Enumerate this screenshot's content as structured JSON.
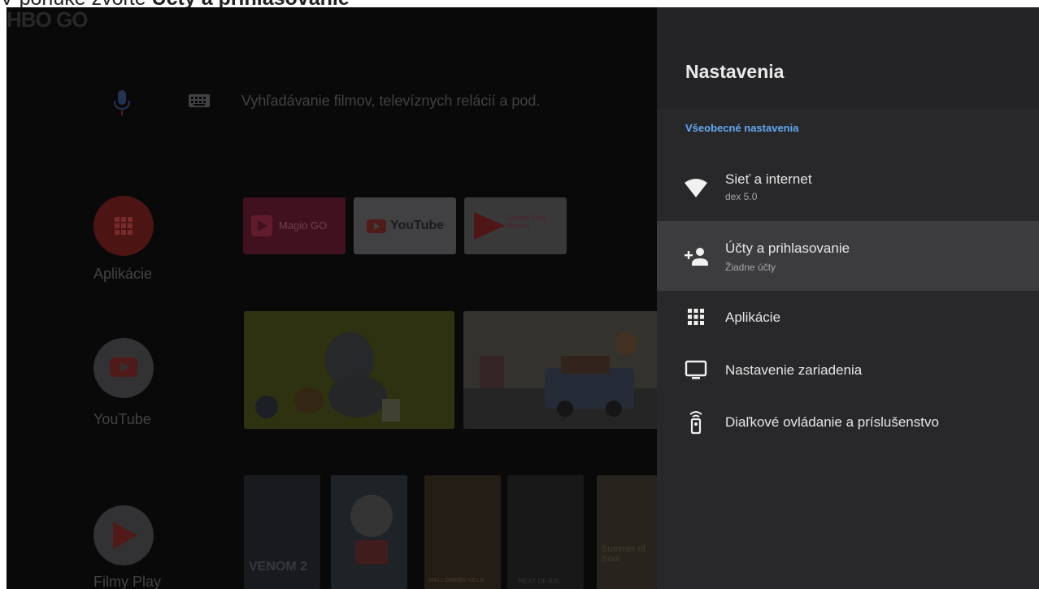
{
  "caption": {
    "prefix": "V ponuke zvoľte ",
    "highlight": "Účty a prihlasovanie"
  },
  "home": {
    "search_placeholder": "Vyhľadávanie filmov, televíznych relácií a pod.",
    "apps_label": "Aplikácie",
    "youtube_label": "YouTube",
    "play_movies_label": "Filmy Play",
    "tiles": {
      "magic": "Magio GO",
      "youtube": "YouTube",
      "google_play": "Google Play Movies",
      "hbo": "HBO GO"
    },
    "posters": [
      "VENOM 2",
      "",
      "HALLOWEEN KILLS",
      "NEXT OF KIN",
      "Summer of Soul"
    ]
  },
  "settings": {
    "title": "Nastavenia",
    "section": "Všeobecné nastavenia",
    "items": [
      {
        "title": "Sieť a internet",
        "subtitle": "dex 5.0",
        "icon": "wifi-icon",
        "selected": false
      },
      {
        "title": "Účty a prihlasovanie",
        "subtitle": "Žiadne účty",
        "icon": "add-account-icon",
        "selected": true
      },
      {
        "title": "Aplikácie",
        "subtitle": "",
        "icon": "apps-grid-icon",
        "selected": false
      },
      {
        "title": "Nastavenie zariadenia",
        "subtitle": "",
        "icon": "tv-icon",
        "selected": false
      },
      {
        "title": "Diaľkové ovládanie a príslušenstvo",
        "subtitle": "",
        "icon": "remote-icon",
        "selected": false
      }
    ]
  },
  "colors": {
    "accent": "#62a8f4",
    "panel": "#28282a",
    "selected": "#3c3c3e"
  }
}
